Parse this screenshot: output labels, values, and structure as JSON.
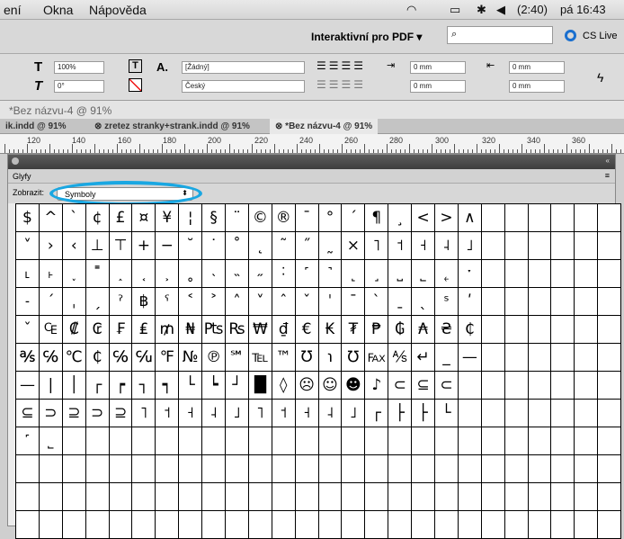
{
  "menubar": {
    "items": [
      "ení",
      "Okna",
      "Nápověda"
    ],
    "battery": "(2:40)",
    "clock": "pá 16:43",
    "search_icon": "magnifier-icon"
  },
  "appbar": {
    "workspace": "Interaktivní pro PDF ▾",
    "cslive": "CS Live"
  },
  "control": {
    "font_size": "100%",
    "angle": "0°",
    "style": "[Žádný]",
    "language": "Český",
    "mm1": "0 mm",
    "mm2": "0 mm",
    "mm3": "0 mm",
    "mm4": "0 mm"
  },
  "document": {
    "title": "*Bez názvu-4 @ 91%",
    "tabs": [
      "ik.indd @ 91%",
      "zretez stranky+strank.indd @ 91%",
      "*Bez názvu-4 @ 91%"
    ]
  },
  "ruler": {
    "labels": [
      "120",
      "140",
      "160",
      "180",
      "200",
      "220",
      "240",
      "260",
      "280",
      "300",
      "320",
      "340",
      "360"
    ]
  },
  "panel": {
    "title": "Glyfy",
    "show_label": "Zobrazit:",
    "show_value": "Symboly"
  },
  "glyphs": [
    [
      "$",
      "^",
      "`",
      "¢",
      "£",
      "¤",
      "¥",
      "¦",
      "§",
      "¨",
      "©",
      "®",
      "¯",
      "°",
      "´",
      "¶",
      "¸",
      "<",
      ">",
      "∧",
      "",
      "",
      "",
      "",
      "",
      ""
    ],
    [
      "˅",
      "›",
      "‹",
      "⊥",
      "⊤",
      "+",
      "−",
      "˘",
      "˙",
      "˚",
      "˛",
      "˜",
      "˝",
      "˷",
      "×",
      "˥",
      "˦",
      "˧",
      "˨",
      "˩",
      "",
      "",
      "",
      "",
      "",
      ""
    ],
    [
      "˪",
      "˫",
      "˯",
      "˭",
      "˰",
      "˱",
      "˲",
      "˳",
      "˴",
      "˵",
      "˶",
      "˸",
      "˹",
      "˺",
      "˻",
      "˼",
      "˽",
      "˾",
      "˿",
      "ˑ",
      "",
      "",
      "",
      "",
      "",
      ""
    ],
    [
      "˗",
      "ˊ",
      "ˌ",
      "ˏ",
      "ˀ",
      "฿",
      "ˁ",
      "˂",
      "˃",
      "˄",
      "˅",
      "ˆ",
      "ˇ",
      "ˈ",
      "ˉ",
      "ˋ",
      "ˍ",
      "ˎ",
      "ˢ",
      "ʹ",
      "",
      "",
      "",
      "",
      "",
      ""
    ],
    [
      "ˇ",
      "₠",
      "₡",
      "₢",
      "₣",
      "₤",
      "₥",
      "₦",
      "₧",
      "₨",
      "₩",
      "₫",
      "€",
      "₭",
      "₮",
      "₱",
      "₲",
      "₳",
      "₴",
      "₵",
      "",
      "",
      "",
      "",
      "",
      ""
    ],
    [
      "℁",
      "℅",
      "℃",
      "₵",
      "℅",
      "℆",
      "℉",
      "№",
      "℗",
      "℠",
      "℡",
      "™",
      "Ʊ",
      "℩",
      "℧",
      "℻",
      "⅍",
      "↵",
      "_",
      "—",
      "",
      "",
      "",
      "",
      "",
      ""
    ],
    [
      "—",
      "|",
      "│",
      "┌",
      "┍",
      "┐",
      "┑",
      "└",
      "┕",
      "┘",
      "█",
      "◊",
      "☹",
      "☺",
      "☻",
      "♪",
      "⊂",
      "⊆",
      "⊂",
      "",
      "",
      "",
      "",
      "",
      "",
      ""
    ],
    [
      "⊆",
      "⊃",
      "⊇",
      "⊃",
      "⊇",
      "˥",
      "˦",
      "˧",
      "˨",
      "˩",
      "˥",
      "˦",
      "˧",
      "˨",
      "˩",
      "┌",
      "├",
      "├",
      "└",
      "",
      "",
      "",
      "",
      "",
      "",
      ""
    ],
    [
      "˹",
      "˾",
      "",
      "",
      "",
      "",
      "",
      "",
      "",
      "",
      "",
      "",
      "",
      "",
      "",
      "",
      "",
      "",
      "",
      "",
      "",
      "",
      "",
      "",
      "",
      ""
    ],
    [
      "",
      "",
      "",
      "",
      "",
      "",
      "",
      "",
      "",
      "",
      "",
      "",
      "",
      "",
      "",
      "",
      "",
      "",
      "",
      "",
      "",
      "",
      "",
      "",
      "",
      ""
    ],
    [
      "",
      "",
      "",
      "",
      "",
      "",
      "",
      "",
      "",
      "",
      "",
      "",
      "",
      "",
      "",
      "",
      "",
      "",
      "",
      "",
      "",
      "",
      "",
      "",
      "",
      ""
    ],
    [
      "",
      "",
      "",
      "",
      "",
      "",
      "",
      "",
      "",
      "",
      "",
      "",
      "",
      "",
      "",
      "",
      "",
      "",
      "",
      "",
      "",
      "",
      "",
      "",
      "",
      ""
    ]
  ]
}
